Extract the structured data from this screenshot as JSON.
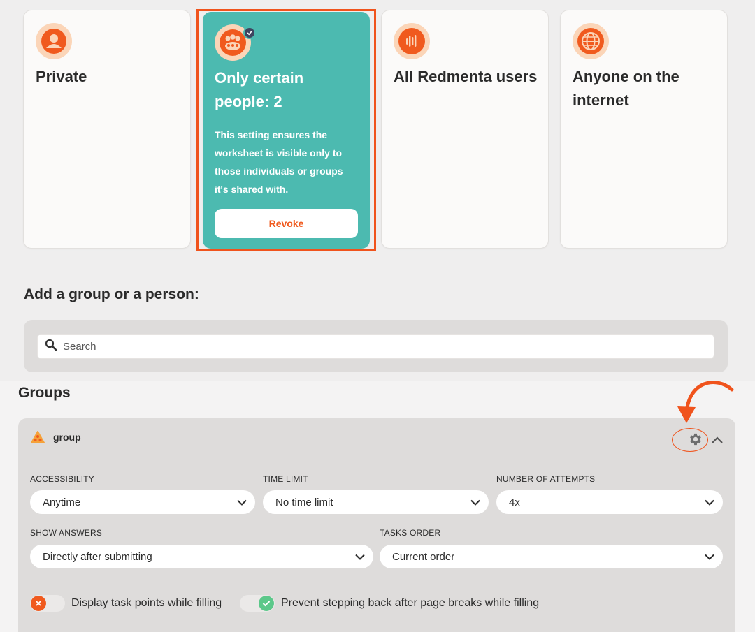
{
  "share_options": [
    {
      "title": "Private",
      "icon": "person-icon"
    },
    {
      "title": "Only certain people: 2",
      "icon": "group-icon",
      "selected": true,
      "description": "This setting ensures the worksheet is visible only to those individuals or groups it's shared with.",
      "button_label": "Revoke"
    },
    {
      "title": "All Redmenta users",
      "icon": "redmenta-logo-icon"
    },
    {
      "title": "Anyone on the internet",
      "icon": "globe-icon"
    }
  ],
  "add_section": {
    "title": "Add a group or a person:",
    "search_placeholder": "Search"
  },
  "groups": {
    "title": "Groups",
    "group": {
      "name": "group",
      "accessibility": {
        "label": "ACCESSIBILITY",
        "value": "Anytime"
      },
      "time_limit": {
        "label": "TIME LIMIT",
        "value": "No time limit"
      },
      "attempts": {
        "label": "NUMBER OF ATTEMPTS",
        "value": "4x"
      },
      "show_answers": {
        "label": "SHOW ANSWERS",
        "value": "Directly after submitting"
      },
      "tasks_order": {
        "label": "TASKS ORDER",
        "value": "Current order"
      },
      "toggle_points": {
        "label": "Display task points while filling",
        "on": false
      },
      "toggle_prevent_back": {
        "label": "Prevent stepping back after page breaks while filling",
        "on": true
      }
    }
  },
  "colors": {
    "accent": "#f05a1e",
    "selected_card": "#4cbab0",
    "toggle_on": "#5cc88a",
    "toggle_off": "#f05a1e"
  }
}
